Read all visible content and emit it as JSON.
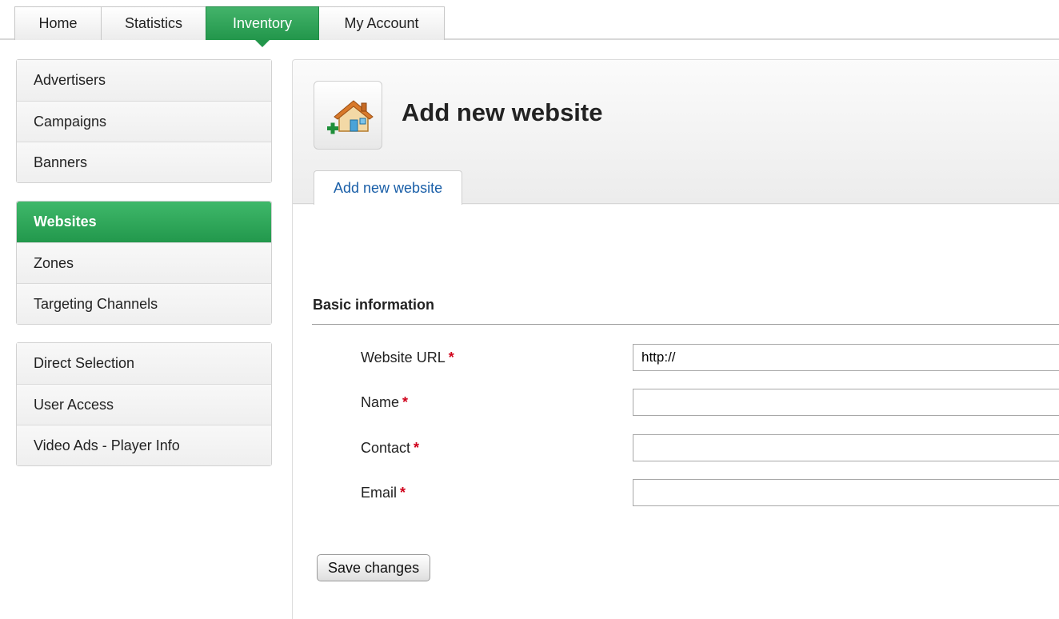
{
  "topnav": {
    "tabs": [
      {
        "label": "Home",
        "active": false
      },
      {
        "label": "Statistics",
        "active": false
      },
      {
        "label": "Inventory",
        "active": true
      },
      {
        "label": "My Account",
        "active": false
      }
    ]
  },
  "sidebar": {
    "group1": [
      "Advertisers",
      "Campaigns",
      "Banners"
    ],
    "group2": [
      "Websites",
      "Zones",
      "Targeting Channels"
    ],
    "group3": [
      "Direct Selection",
      "User Access",
      "Video Ads - Player Info"
    ],
    "active": "Websites"
  },
  "page": {
    "title": "Add new website",
    "icon": "add-website-house-icon",
    "subtab": "Add new website"
  },
  "form": {
    "section_title": "Basic information",
    "required_mark": "*",
    "fields": [
      {
        "label": "Website URL",
        "value": "http://"
      },
      {
        "label": "Name",
        "value": ""
      },
      {
        "label": "Contact",
        "value": ""
      },
      {
        "label": "Email",
        "value": ""
      }
    ],
    "save_label": "Save changes"
  },
  "colors": {
    "accent_green": "#22964b",
    "link_blue": "#1a5fa8",
    "required_red": "#d0021b"
  }
}
